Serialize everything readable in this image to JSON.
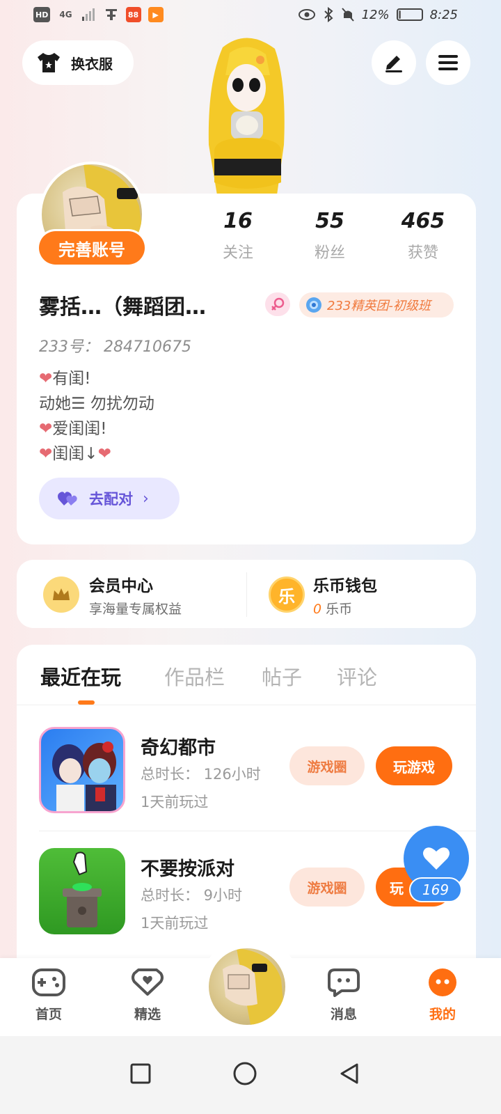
{
  "status_bar": {
    "left_icons": [
      "HD",
      "4G",
      "signal-icon",
      "notification-icon",
      "app-icon-red",
      "app-icon-orange"
    ],
    "battery_percent": "12%",
    "battery_level": 0.12,
    "time": "8:25",
    "right_icons": [
      "eye-icon",
      "bluetooth-icon",
      "mute-icon",
      "battery-icon"
    ]
  },
  "header": {
    "outfit_button_label": "换衣服",
    "edit_icon": "pen-icon",
    "menu_icon": "hamburger-icon"
  },
  "profile": {
    "complete_account_label": "完善账号",
    "stats": [
      {
        "value": "16",
        "label": "关注"
      },
      {
        "value": "55",
        "label": "粉丝"
      },
      {
        "value": "465",
        "label": "获赞"
      }
    ],
    "username": "雾括…（舞蹈团…",
    "gender_icon": "female-icon",
    "level_badge": "233精英团-初级班",
    "uid": "233号：  284710675",
    "bio_lines": [
      "有闺!",
      "动她☰  勿扰勿动",
      "爱闺闺!",
      "闺闺↓"
    ],
    "match_button_label": "去配对"
  },
  "wallet": {
    "vip_title": "会员中心",
    "vip_subtitle": "享海量专属权益",
    "coin_title": "乐币钱包",
    "coin_amount": "0",
    "coin_unit": "乐币",
    "coin_glyph": "乐"
  },
  "tabs": [
    "最近在玩",
    "作品栏",
    "帖子",
    "评论"
  ],
  "games": [
    {
      "title": "奇幻都市",
      "total_time": "总时长：  126小时",
      "last_played": "1天前玩过",
      "circle_label": "游戏圈",
      "play_label": "玩游戏"
    },
    {
      "title": "不要按派对",
      "total_time": "总时长：  9小时",
      "last_played": "1天前玩过",
      "circle_label": "游戏圈",
      "play_label": "玩"
    }
  ],
  "like_count": "169",
  "bottom_nav": [
    {
      "label": "首页",
      "icon": "gamepad-icon"
    },
    {
      "label": "精选",
      "icon": "heart-bubble-icon"
    },
    {
      "label": "消息",
      "icon": "chat-icon"
    },
    {
      "label": "我的",
      "icon": "profile-face-icon"
    }
  ],
  "colors": {
    "accent": "#ff6e11",
    "accent_light": "#fde6dc",
    "like_blue": "#3a8ef3",
    "match_bg": "#e9e8ff",
    "match_text": "#6655d8"
  }
}
